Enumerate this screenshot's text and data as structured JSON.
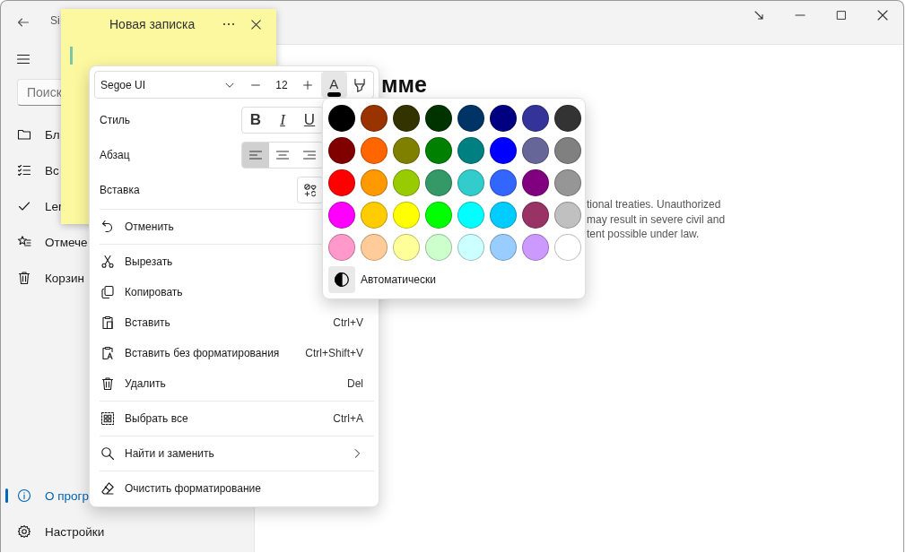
{
  "window": {
    "title": "Si"
  },
  "sidebar": {
    "search": {
      "placeholder": "Поиск"
    },
    "items": [
      {
        "label": "Бл",
        "selected": false
      },
      {
        "label": "Вс",
        "selected": false
      },
      {
        "label": "Ler",
        "selected": false
      },
      {
        "label": "Отмече",
        "selected": false
      },
      {
        "label": "Корзин",
        "selected": false
      }
    ],
    "footer_items": [
      {
        "label": "О прогр",
        "selected": true
      },
      {
        "label": "Настройки",
        "selected": false
      }
    ]
  },
  "main": {
    "heading": "мме",
    "paragraph_lines": [
      "tional treaties. Unauthorized",
      "may result in severe civil and",
      "tent possible under law."
    ]
  },
  "note": {
    "title": "Новая записка"
  },
  "context_menu": {
    "toolbar": {
      "font_name": "Segoe UI",
      "font_size": "12",
      "font_color": {
        "label": "A",
        "selected": true
      },
      "highlight": {
        "selected": false
      }
    },
    "format_rows": [
      {
        "label": "Стиль",
        "kind": "toggles",
        "buttons": [
          {
            "label": "B",
            "selected": false
          },
          {
            "label": "I",
            "selected": false
          },
          {
            "label": "U",
            "selected": false
          }
        ]
      },
      {
        "label": "Абзац",
        "kind": "align",
        "buttons": [
          {
            "selected": true
          },
          {
            "selected": false
          },
          {
            "selected": false
          }
        ]
      },
      {
        "label": "Вставка",
        "kind": "insert"
      }
    ],
    "sections": [
      {
        "items": [
          {
            "label": "Отменить"
          }
        ]
      },
      {
        "items": [
          {
            "label": "Вырезать"
          },
          {
            "label": "Копировать"
          },
          {
            "label": "Вставить",
            "shortcut": "Ctrl+V"
          },
          {
            "label": "Вставить без форматирования",
            "shortcut": "Ctrl+Shift+V"
          },
          {
            "label": "Удалить",
            "shortcut": "Del"
          }
        ]
      },
      {
        "items": [
          {
            "label": "Выбрать все",
            "shortcut": "Ctrl+A"
          }
        ]
      },
      {
        "items": [
          {
            "label": "Найти и заменить",
            "submenu": true
          }
        ]
      },
      {
        "items": [
          {
            "label": "Очистить форматирование"
          }
        ]
      }
    ]
  },
  "color_picker": {
    "swatches": [
      {
        "color": "#000000"
      },
      {
        "color": "#993300"
      },
      {
        "color": "#333300"
      },
      {
        "color": "#003300"
      },
      {
        "color": "#003366"
      },
      {
        "color": "#000080"
      },
      {
        "color": "#333399"
      },
      {
        "color": "#333333"
      },
      {
        "color": "#800000"
      },
      {
        "color": "#ff6600"
      },
      {
        "color": "#808000"
      },
      {
        "color": "#008000"
      },
      {
        "color": "#008080"
      },
      {
        "color": "#0000ff"
      },
      {
        "color": "#666699"
      },
      {
        "color": "#808080"
      },
      {
        "color": "#ff0000"
      },
      {
        "color": "#ff9900"
      },
      {
        "color": "#99cc00"
      },
      {
        "color": "#339966"
      },
      {
        "color": "#33cccc"
      },
      {
        "color": "#3366ff"
      },
      {
        "color": "#800080"
      },
      {
        "color": "#969696"
      },
      {
        "color": "#ff00ff"
      },
      {
        "color": "#ffcc00"
      },
      {
        "color": "#ffff00"
      },
      {
        "color": "#00ff00"
      },
      {
        "color": "#00ffff"
      },
      {
        "color": "#00ccff"
      },
      {
        "color": "#993366"
      },
      {
        "color": "#c0c0c0"
      },
      {
        "color": "#ff99cc"
      },
      {
        "color": "#ffcc99"
      },
      {
        "color": "#ffff99"
      },
      {
        "color": "#ccffcc"
      },
      {
        "color": "#ccffff"
      },
      {
        "color": "#99ccff"
      },
      {
        "color": "#cc99ff"
      },
      {
        "color": "#ffffff"
      }
    ],
    "automatic": {
      "label": "Автоматически"
    }
  }
}
